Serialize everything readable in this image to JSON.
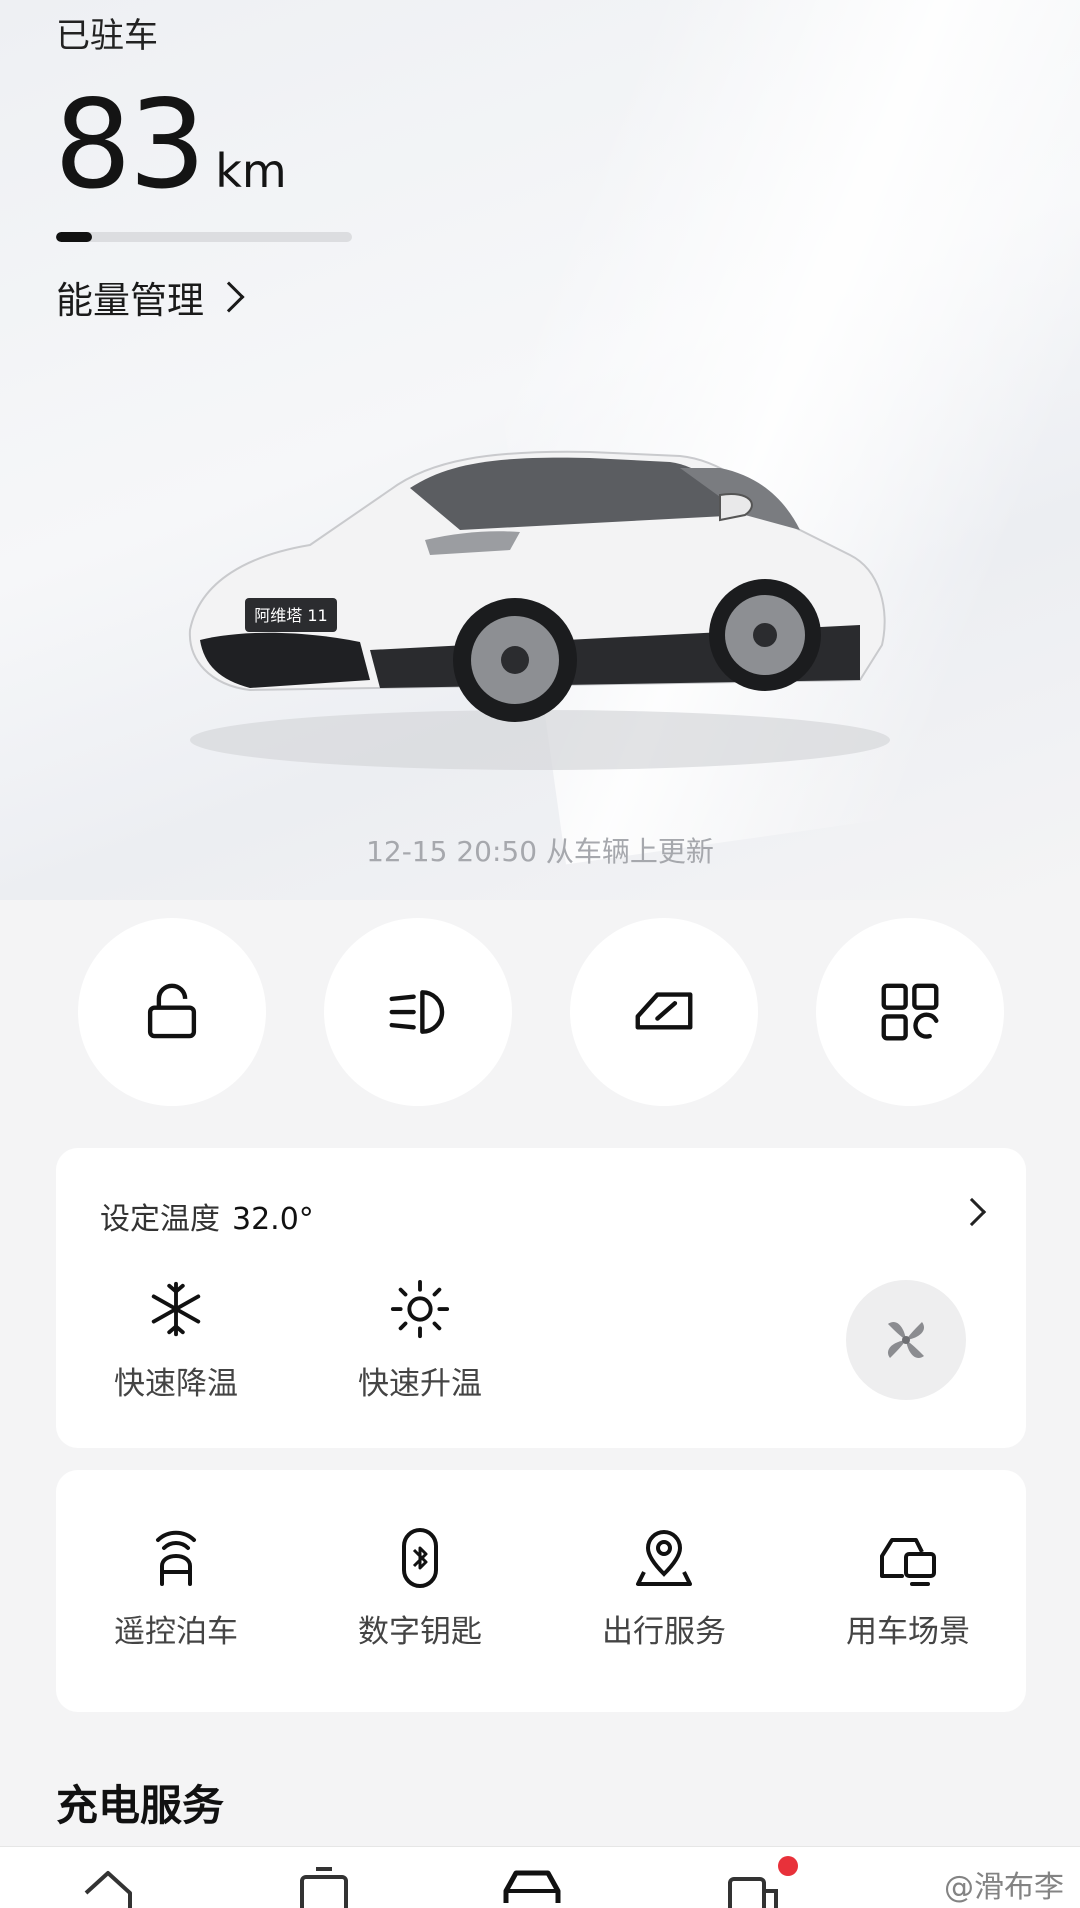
{
  "header": {
    "status": "已驻车",
    "range_value": "83",
    "range_unit": "km",
    "range_fill_fraction": 0.12,
    "energy_link": "能量管理"
  },
  "car": {
    "plate": "阿维塔 11"
  },
  "update_text": "12-15 20:50 从车辆上更新",
  "quick_actions": [
    {
      "icon": "unlock-icon"
    },
    {
      "icon": "headlight-icon"
    },
    {
      "icon": "window-icon"
    },
    {
      "icon": "apps-grid-icon"
    }
  ],
  "climate": {
    "label": "设定温度",
    "value": "32.0°",
    "actions": [
      {
        "label": "快速降温",
        "icon": "snowflake-icon"
      },
      {
        "label": "快速升温",
        "icon": "sun-icon"
      }
    ],
    "fan_icon": "fan-icon"
  },
  "services": [
    {
      "label": "遥控泊车",
      "icon": "remote-parking-icon"
    },
    {
      "label": "数字钥匙",
      "icon": "bluetooth-key-icon"
    },
    {
      "label": "出行服务",
      "icon": "location-pin-icon"
    },
    {
      "label": "用车场景",
      "icon": "car-scene-icon"
    }
  ],
  "section_title": "充电服务",
  "watermark": "@滑布李",
  "colors": {
    "accent_badge": "#e8313a",
    "text_primary": "#141414",
    "text_muted": "#a6a8ad"
  }
}
